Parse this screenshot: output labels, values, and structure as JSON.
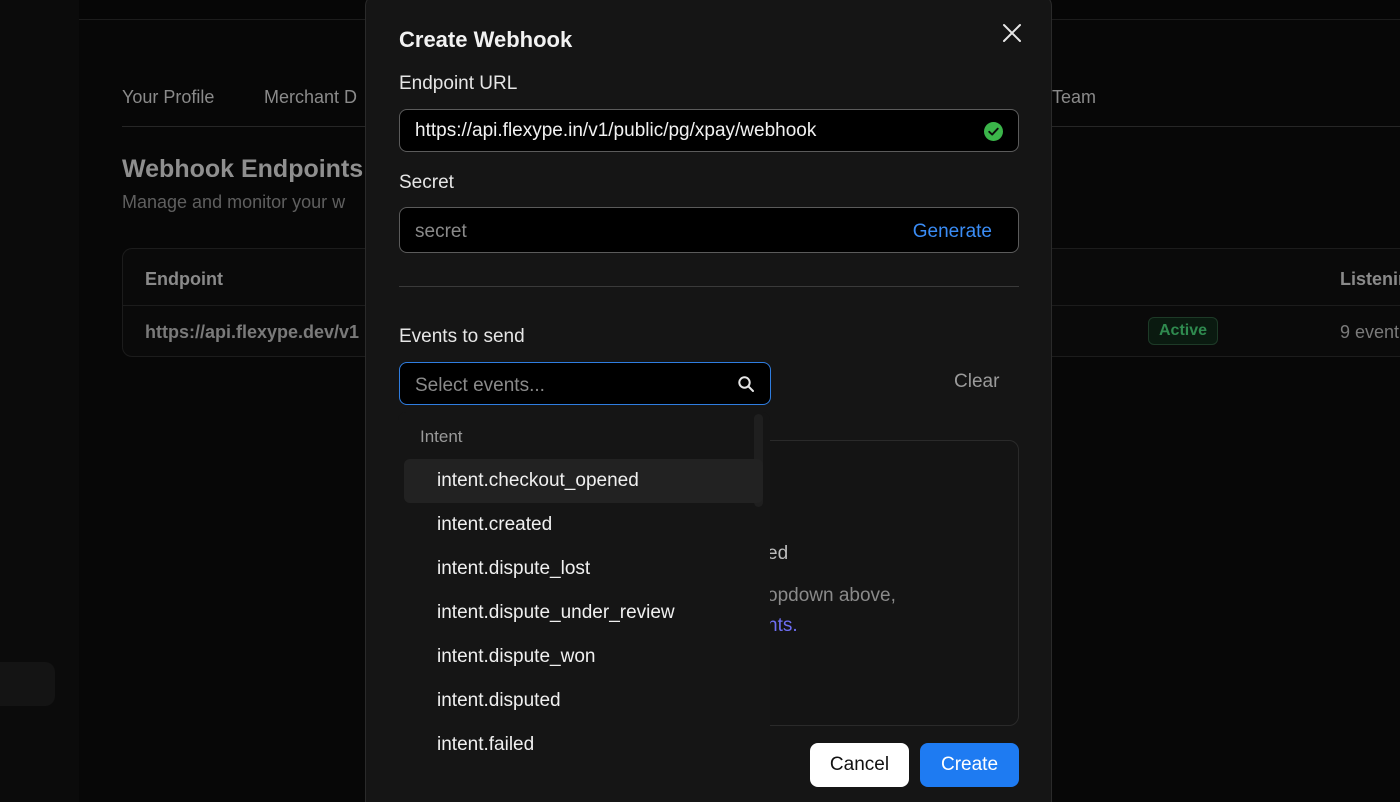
{
  "background": {
    "tabs": [
      "Your Profile",
      "Merchant D",
      "Team"
    ],
    "title": "Webhook Endpoints",
    "subtitle": "Manage and monitor your w",
    "table": {
      "headers": [
        "Endpoint",
        "Listenin"
      ],
      "row": {
        "endpoint": "https://api.flexype.dev/v1",
        "status": "Active",
        "listening": "9 event"
      }
    }
  },
  "modal": {
    "title": "Create Webhook",
    "endpoint_label": "Endpoint URL",
    "endpoint_value": "https://api.flexype.in/v1/public/pg/xpay/webhook",
    "secret_label": "Secret",
    "secret_placeholder": "secret",
    "generate_label": "Generate",
    "events_label": "Events to send",
    "events_placeholder": "Select events...",
    "clear_label": "Clear",
    "empty_title_fragment": "ed",
    "empty_desc_fragment": "opdown above,",
    "empty_link_fragment": "nts.",
    "cancel_label": "Cancel",
    "create_label": "Create"
  },
  "dropdown": {
    "group": "Intent",
    "items": [
      "intent.checkout_opened",
      "intent.created",
      "intent.dispute_lost",
      "intent.dispute_under_review",
      "intent.dispute_won",
      "intent.disputed",
      "intent.failed"
    ]
  },
  "colors": {
    "accent": "#1e7bf2",
    "success": "#3bb54a",
    "active_badge": "#2f8a4f",
    "link": "#6d6df2"
  },
  "icons": [
    "close-icon",
    "check-circle-icon",
    "search-icon"
  ]
}
